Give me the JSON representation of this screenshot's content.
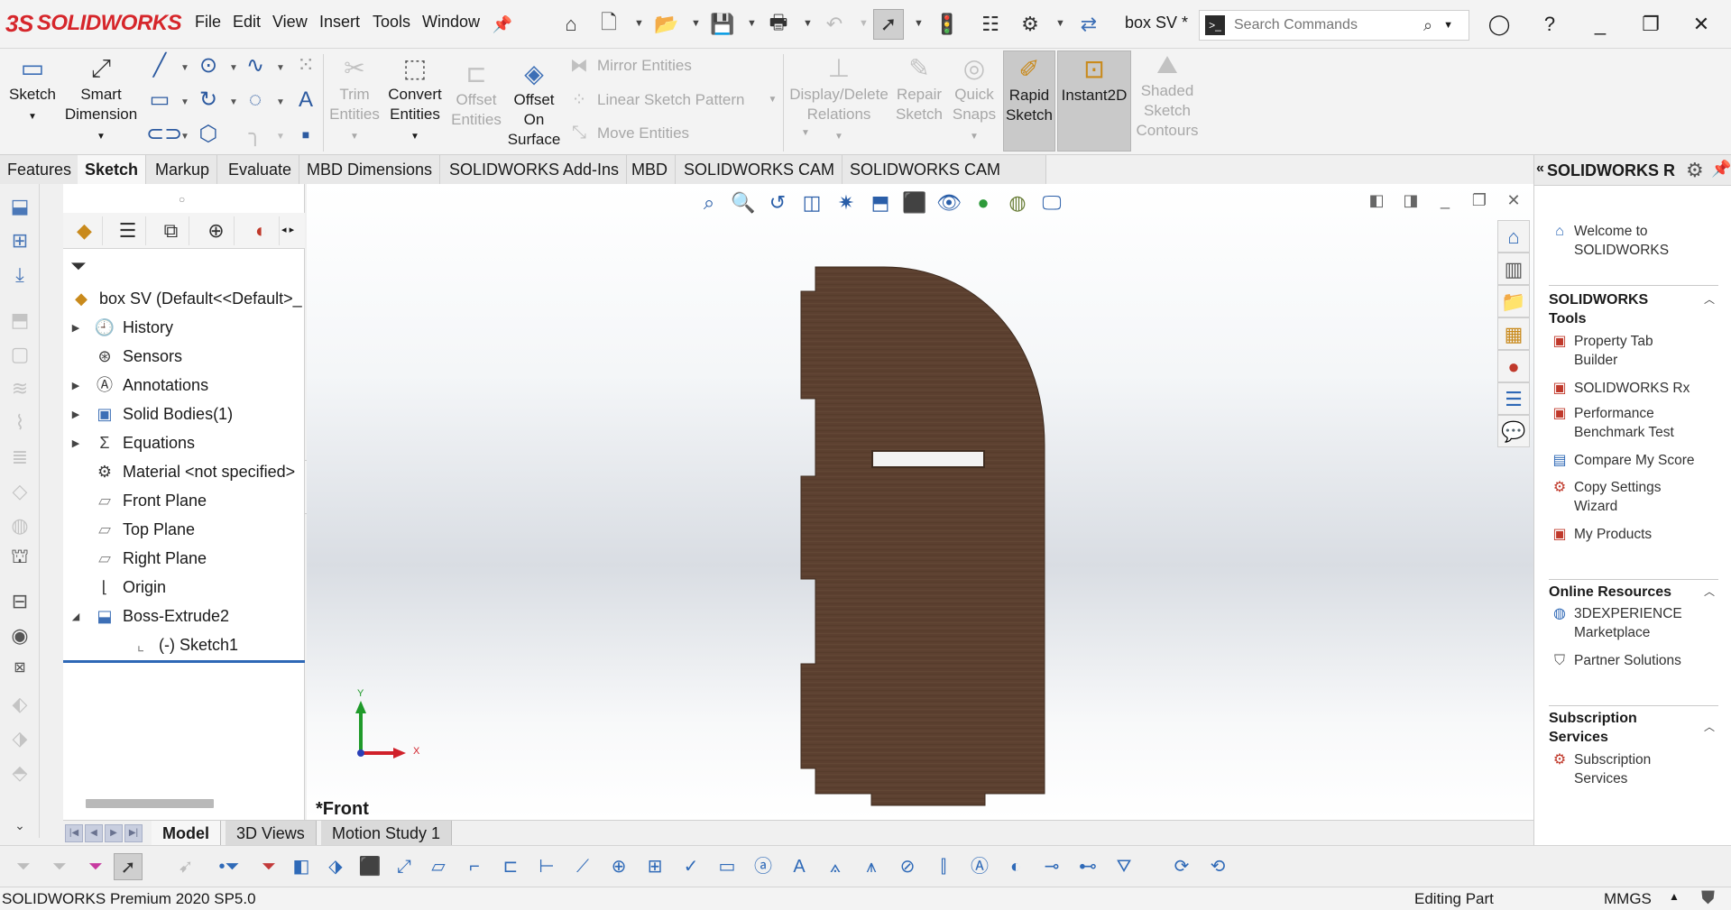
{
  "app": {
    "brand_prefix": "3S",
    "brand_name": "SOLIDWORKS",
    "menu": [
      "File",
      "Edit",
      "View",
      "Insert",
      "Tools",
      "Window"
    ],
    "doc_title": "box SV *",
    "search_placeholder": "Search Commands"
  },
  "ribbon": {
    "sketch": "Sketch",
    "smart_dimension": [
      "Smart",
      "Dimension"
    ],
    "trim_entities": [
      "Trim",
      "Entities"
    ],
    "convert_entities": [
      "Convert",
      "Entities"
    ],
    "offset_entities": [
      "Offset",
      "Entities"
    ],
    "offset_on_surface": [
      "Offset",
      "On",
      "Surface"
    ],
    "mirror_entities": "Mirror Entities",
    "linear_sketch_pattern": "Linear Sketch Pattern",
    "move_entities": "Move Entities",
    "display_delete_relations": [
      "Display/Delete",
      "Relations"
    ],
    "repair_sketch": [
      "Repair",
      "Sketch"
    ],
    "quick_snaps": [
      "Quick",
      "Snaps"
    ],
    "rapid_sketch": [
      "Rapid",
      "Sketch"
    ],
    "instant2d": "Instant2D",
    "shaded_sketch_contours": [
      "Shaded",
      "Sketch",
      "Contours"
    ]
  },
  "tabs": [
    "Features",
    "Sketch",
    "Markup",
    "Evaluate",
    "MBD Dimensions",
    "SOLIDWORKS Add-Ins",
    "MBD",
    "SOLIDWORKS CAM",
    "SOLIDWORKS CAM TBM"
  ],
  "active_tab": "Sketch",
  "feature_tree": {
    "root": "box SV  (Default<<Default>_",
    "items": [
      {
        "label": "History",
        "expandable": true,
        "icon": "history-icon"
      },
      {
        "label": "Sensors",
        "expandable": false,
        "icon": "sensors-icon"
      },
      {
        "label": "Annotations",
        "expandable": true,
        "icon": "annotations-icon"
      },
      {
        "label": "Solid Bodies(1)",
        "expandable": true,
        "icon": "solid-bodies-icon"
      },
      {
        "label": "Equations",
        "expandable": true,
        "icon": "equations-icon"
      },
      {
        "label": "Material <not specified>",
        "expandable": false,
        "icon": "material-icon"
      },
      {
        "label": "Front Plane",
        "expandable": false,
        "icon": "plane-icon"
      },
      {
        "label": "Top Plane",
        "expandable": false,
        "icon": "plane-icon"
      },
      {
        "label": "Right Plane",
        "expandable": false,
        "icon": "plane-icon"
      },
      {
        "label": "Origin",
        "expandable": false,
        "icon": "origin-icon"
      },
      {
        "label": "Boss-Extrude2",
        "expandable": true,
        "expanded": true,
        "icon": "boss-extrude-icon"
      },
      {
        "label": "(-) Sketch1",
        "expandable": false,
        "icon": "sketch-icon",
        "child": true
      }
    ]
  },
  "viewport": {
    "view_label": "*Front",
    "triad_x": "X",
    "triad_y": "Y",
    "part_color": "#5c4030"
  },
  "bottom_tabs": [
    "Model",
    "3D Views",
    "Motion Study 1"
  ],
  "active_bottom_tab": "Model",
  "status": {
    "product": "SOLIDWORKS Premium 2020 SP5.0",
    "mode": "Editing Part",
    "units": "MMGS"
  },
  "task_pane": {
    "title": "SOLIDWORKS Resources",
    "welcome": [
      "Welcome to",
      "SOLIDWORKS"
    ],
    "sections": [
      {
        "title": [
          "SOLIDWORKS",
          "Tools"
        ],
        "items": [
          {
            "label": [
              "Property Tab",
              "Builder"
            ],
            "icon": "property-tab-builder-icon"
          },
          {
            "label": [
              "SOLIDWORKS Rx"
            ],
            "icon": "solidworks-rx-icon"
          },
          {
            "label": [
              "Performance",
              "Benchmark Test"
            ],
            "icon": "benchmark-icon"
          },
          {
            "label": [
              "Compare My Score"
            ],
            "icon": "compare-score-icon"
          },
          {
            "label": [
              "Copy Settings",
              "Wizard"
            ],
            "icon": "copy-settings-icon"
          },
          {
            "label": [
              "My Products"
            ],
            "icon": "my-products-icon"
          }
        ]
      },
      {
        "title": [
          "Online Resources"
        ],
        "items": [
          {
            "label": [
              "3DEXPERIENCE",
              "Marketplace"
            ],
            "icon": "marketplace-icon"
          },
          {
            "label": [
              "Partner Solutions"
            ],
            "icon": "partner-solutions-icon"
          }
        ]
      },
      {
        "title": [
          "Subscription",
          "Services"
        ],
        "items": [
          {
            "label": [
              "Subscription",
              "Services"
            ],
            "icon": "subscription-icon"
          }
        ]
      }
    ]
  }
}
